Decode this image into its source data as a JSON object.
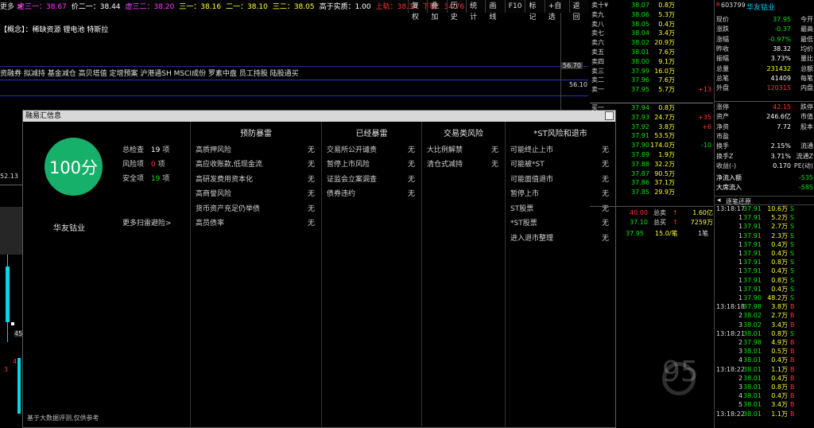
{
  "topbar": {
    "menu": "更多 >",
    "ma_items": [
      {
        "label": "虚三一：38.67",
        "color": "#ff33ff",
        "marker": "↓"
      },
      {
        "label": "价二一：38.44",
        "color": "#ffffff",
        "marker": "↓"
      },
      {
        "label": "虚三二：38.20",
        "color": "#ff33ff",
        "marker": "↓"
      },
      {
        "label": "三一：38.16",
        "color": "#ffff33",
        "marker": ""
      },
      {
        "label": "二一：38.10",
        "color": "#ffff33",
        "marker": ""
      },
      {
        "label": "三二：38.05",
        "color": "#ffff33",
        "marker": ""
      },
      {
        "label": "高于实质：1.00",
        "color": "#ffffff",
        "marker": ""
      },
      {
        "label": "上轨：38.34",
        "color": "#ff3333",
        "marker": "↑"
      },
      {
        "label": "下轨：34.76",
        "color": "#ff3333",
        "marker": ""
      }
    ],
    "toolbar": [
      "复权",
      "叠加",
      "历史",
      "统计",
      "画线",
      "F10",
      "标记",
      "+自选",
      "返回"
    ]
  },
  "concept": {
    "label": "【概念】：",
    "text": "稀缺资源  锂电池  特斯拉"
  },
  "tags": "资融券  拟减持  基金减仓  高贝塔值  定增预案  沪港通SH  MSCI成份  罗素中盘  员工持股  陆股通买",
  "chart": {
    "price_label_1": "56.70",
    "price_label_2": "56.10",
    "left_axis_label": "52.13",
    "mini_labels": [
      "4",
      "3",
      "45"
    ]
  },
  "dialog": {
    "title": "融易汇信息",
    "score": "100分",
    "company": "华友钴业",
    "stats": [
      {
        "label": "总检查",
        "value": "19",
        "unit": "项",
        "color": "#ffffff"
      },
      {
        "label": "风险项",
        "value": "0",
        "unit": "项",
        "color": "#ff3333"
      },
      {
        "label": "安全项",
        "value": "19",
        "unit": "项",
        "color": "#00e600"
      }
    ],
    "more": "更多扫雷避险>",
    "disclaimer": "基于大数据评测,仅供参考",
    "columns": [
      {
        "head": "预防暴雷",
        "items": [
          {
            "name": "高质押风险",
            "value": "无"
          },
          {
            "name": "高应收账款,低现金流",
            "value": "无"
          },
          {
            "name": "高研发费用资本化",
            "value": "无"
          },
          {
            "name": "高商誉风险",
            "value": "无"
          },
          {
            "name": "货币资产充足仍举债",
            "value": "无"
          },
          {
            "name": "高员债率",
            "value": "无"
          }
        ]
      },
      {
        "head": "已经暴雷",
        "items": [
          {
            "name": "交易所公开谴责",
            "value": "无"
          },
          {
            "name": "暂停上市风险",
            "value": "无"
          },
          {
            "name": "证监会立案调查",
            "value": "无"
          },
          {
            "name": "债券违约",
            "value": "无"
          }
        ]
      },
      {
        "head": "交易类风险",
        "items": [
          {
            "name": "大比例解禁",
            "value": "无"
          },
          {
            "name": "清仓式减持",
            "value": "无"
          }
        ]
      },
      {
        "head": "*ST风险和退市",
        "items": [
          {
            "name": "可能终止上市",
            "value": "无"
          },
          {
            "name": "可能被*ST",
            "value": "无"
          },
          {
            "name": "可能面值退市",
            "value": "无"
          },
          {
            "name": "暂停上市",
            "value": "无"
          },
          {
            "name": "ST股票",
            "value": "无"
          },
          {
            "name": "*ST股票",
            "value": "无"
          },
          {
            "name": "进入退市整理",
            "value": "无"
          }
        ]
      }
    ]
  },
  "book": {
    "sells": [
      {
        "label": "卖十¥",
        "price": "38.07",
        "vol": "0.8万"
      },
      {
        "label": "卖九",
        "price": "38.06",
        "vol": "5.3万"
      },
      {
        "label": "卖八",
        "price": "38.05",
        "vol": "0.4万"
      },
      {
        "label": "卖七",
        "price": "38.04",
        "vol": "3.4万"
      },
      {
        "label": "卖六",
        "price": "38.02",
        "vol": "20.9万"
      },
      {
        "label": "卖五",
        "price": "38.01",
        "vol": "7.6万"
      },
      {
        "label": "卖四",
        "price": "38.00",
        "vol": "9.1万"
      },
      {
        "label": "卖三",
        "price": "37.99",
        "vol": "16.0万"
      },
      {
        "label": "卖二",
        "price": "37.96",
        "vol": "7.6万"
      },
      {
        "label": "卖一",
        "price": "37.95",
        "vol": "5.7万",
        "chg": "+13"
      }
    ],
    "buys": [
      {
        "label": "买一",
        "price": "37.94",
        "vol": "0.8万",
        "chg": ""
      },
      {
        "label": "",
        "price": "37.93",
        "vol": "24.7万",
        "chg": "+35"
      },
      {
        "label": "",
        "price": "37.92",
        "vol": "3.8万",
        "chg": "+6"
      },
      {
        "label": "",
        "price": "37.91",
        "vol": "53.5万",
        "chg": ""
      },
      {
        "label": "",
        "price": "37.90",
        "vol": "174.0万",
        "chg": "-10"
      },
      {
        "label": "",
        "price": "37.89",
        "vol": "1.9万",
        "chg": ""
      },
      {
        "label": "",
        "price": "37.88",
        "vol": "32.2万",
        "chg": ""
      },
      {
        "label": "",
        "price": "37.87",
        "vol": "90.5万",
        "chg": ""
      },
      {
        "label": "",
        "price": "37.86",
        "vol": "37.1万",
        "chg": ""
      },
      {
        "label": "",
        "price": "37.85",
        "vol": "29.9万",
        "chg": ""
      }
    ],
    "sell_total": {
      "price": "40.00",
      "label": "总卖",
      "value": "1.60亿"
    },
    "buy_total": {
      "price": "37.10",
      "label": "总买",
      "value": "7259万"
    },
    "last": {
      "price": "37.95",
      "vol": "15.0/笔",
      "count": "1笔"
    }
  },
  "info": {
    "code": "603799",
    "name": "华友钴业",
    "rows": [
      {
        "l": "现价",
        "v": "37.95",
        "c": "#00e600",
        "l2": "今开"
      },
      {
        "l": "涨跌",
        "v": "-0.37",
        "c": "#00e600",
        "l2": "最高"
      },
      {
        "l": "涨幅",
        "v": "-0.97%",
        "c": "#00e600",
        "l2": "最低"
      },
      {
        "l": "昨收",
        "v": "38.32",
        "c": "#ffffff",
        "l2": "均价"
      },
      {
        "l": "振幅",
        "v": "3.73%",
        "c": "#ffffff",
        "l2": "量比"
      },
      {
        "l": "总量",
        "v": "231432",
        "c": "#ffff33",
        "l2": "总额"
      },
      {
        "l": "总笔",
        "v": "41409",
        "c": "#ffffff",
        "l2": "每笔"
      },
      {
        "l": "外盘",
        "v": "120315",
        "c": "#ff3333",
        "l2": "内盘"
      },
      {
        "l": "涨停",
        "v": "42.15",
        "c": "#ff3333",
        "l2": "跌停"
      },
      {
        "l": "资产",
        "v": "246.6亿",
        "c": "#ffffff",
        "l2": "市值"
      },
      {
        "l": "净资",
        "v": "7.72",
        "c": "#ffffff",
        "l2": "股本"
      },
      {
        "l": "市盈",
        "v": "",
        "c": "#ffffff",
        "l2": ""
      },
      {
        "l": "换手",
        "v": "2.15%",
        "c": "#ffffff",
        "l2": "流通"
      },
      {
        "l": "换手Z",
        "v": "3.71%",
        "c": "#ffffff",
        "l2": "流通Z"
      },
      {
        "l": "收益(-)",
        "v": "0.170",
        "c": "#ffffff",
        "l2": "PE(动)"
      }
    ],
    "flow": [
      {
        "l": "净流入额",
        "v": "-535"
      },
      {
        "l": "大席流入",
        "v": "-585"
      }
    ],
    "ticks_title": "逐笔还原",
    "ticks": [
      {
        "t": "13:18:17",
        "p": "37.91",
        "a": "10.6万",
        "d": "S"
      },
      {
        "t": "1",
        "p": "37.91",
        "a": "5.2万",
        "d": "S"
      },
      {
        "t": "1",
        "p": "37.91",
        "a": "2.7万",
        "d": "S"
      },
      {
        "t": "1",
        "p": "37.91",
        "a": "2.3万",
        "d": "S"
      },
      {
        "t": "1",
        "p": "37.91",
        "a": "0.4万",
        "d": "S"
      },
      {
        "t": "1",
        "p": "37.91",
        "a": "0.4万",
        "d": "S"
      },
      {
        "t": "1",
        "p": "37.91",
        "a": "0.8万",
        "d": "S"
      },
      {
        "t": "1",
        "p": "37.91",
        "a": "0.4万",
        "d": "S"
      },
      {
        "t": "1",
        "p": "37.91",
        "a": "0.8万",
        "d": "S"
      },
      {
        "t": "1",
        "p": "37.91",
        "a": "0.4万",
        "d": "S"
      },
      {
        "t": "1",
        "p": "37.90",
        "a": "48.2万",
        "d": "S"
      },
      {
        "t": "13:18:18",
        "p": "37.98",
        "a": "3.8万",
        "d": "B"
      },
      {
        "t": "2",
        "p": "38.02",
        "a": "2.7万",
        "d": "B"
      },
      {
        "t": "3",
        "p": "38.02",
        "a": "3.4万",
        "d": "B"
      },
      {
        "t": "13:18:21",
        "p": "38.01",
        "a": "0.8万",
        "d": "S"
      },
      {
        "t": "2",
        "p": "37.98",
        "a": "4.9万",
        "d": "B"
      },
      {
        "t": "3",
        "p": "38.01",
        "a": "0.5万",
        "d": "B"
      },
      {
        "t": "4",
        "p": "38.01",
        "a": "0.4万",
        "d": "B"
      },
      {
        "t": "13:18:22",
        "p": "38.01",
        "a": "1.1万",
        "d": "B"
      },
      {
        "t": "2",
        "p": "38.01",
        "a": "0.4万",
        "d": "B"
      },
      {
        "t": "3",
        "p": "38.01",
        "a": "0.8万",
        "d": "B"
      },
      {
        "t": "4",
        "p": "38.01",
        "a": "0.4万",
        "d": "B"
      },
      {
        "t": "5",
        "p": "38.01",
        "a": "3.4万",
        "d": "B"
      },
      {
        "t": "13:18:22",
        "p": "38.01",
        "a": "1.1万",
        "d": "B"
      }
    ]
  },
  "watermark": "95",
  "colors": {
    "up": "#ff3333",
    "down": "#00e600",
    "vol": "#ffff33",
    "score": "#17b06a"
  }
}
